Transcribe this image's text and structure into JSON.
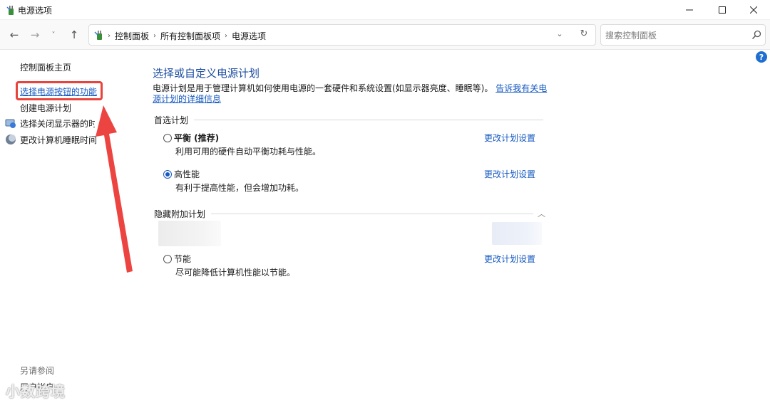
{
  "window": {
    "title": "电源选项",
    "minimize_label": "—",
    "maximize_label": "☐",
    "close_label": "✕"
  },
  "nav": {
    "back_glyph": "←",
    "forward_glyph": "→",
    "history_glyph": "˅",
    "up_glyph": "↑",
    "breadcrumbs": [
      "控制面板",
      "所有控制面板项",
      "电源选项"
    ],
    "crumb_separator": "›",
    "dropdown_glyph": "⌄",
    "refresh_glyph": "↻"
  },
  "search": {
    "placeholder": "搜索控制面板",
    "value": ""
  },
  "help_label": "?",
  "sidebar": {
    "home": "控制面板主页",
    "links": [
      "选择电源按钮的功能",
      "创建电源计划",
      "选择关闭显示器的时间",
      "更改计算机睡眠时间"
    ],
    "see_also": "另请参阅",
    "user_accounts": "用户帐户"
  },
  "main": {
    "title": "选择或自定义电源计划",
    "description": "电源计划是用于管理计算机如何使用电源的一套硬件和系统设置(如显示器亮度、睡眠等)。",
    "description_link": "告诉我有关电源计划的详细信息",
    "preferred_group": "首选计划",
    "hidden_group": "隐藏附加计划",
    "collapse_glyph": "︿",
    "plans": [
      {
        "name": "平衡 (推荐)",
        "desc": "利用可用的硬件自动平衡功耗与性能。",
        "link": "更改计划设置",
        "selected": false
      },
      {
        "name": "高性能",
        "desc": "有利于提高性能，但会增加功耗。",
        "link": "更改计划设置",
        "selected": true
      },
      {
        "name": "节能",
        "desc": "尽可能降低计算机性能以节能。",
        "link": "更改计划设置",
        "selected": false
      }
    ]
  },
  "watermark": "小数跨境",
  "colors": {
    "link": "#1659c0",
    "title_blue": "#1e4fa0",
    "annotation_red": "#e8433c"
  }
}
